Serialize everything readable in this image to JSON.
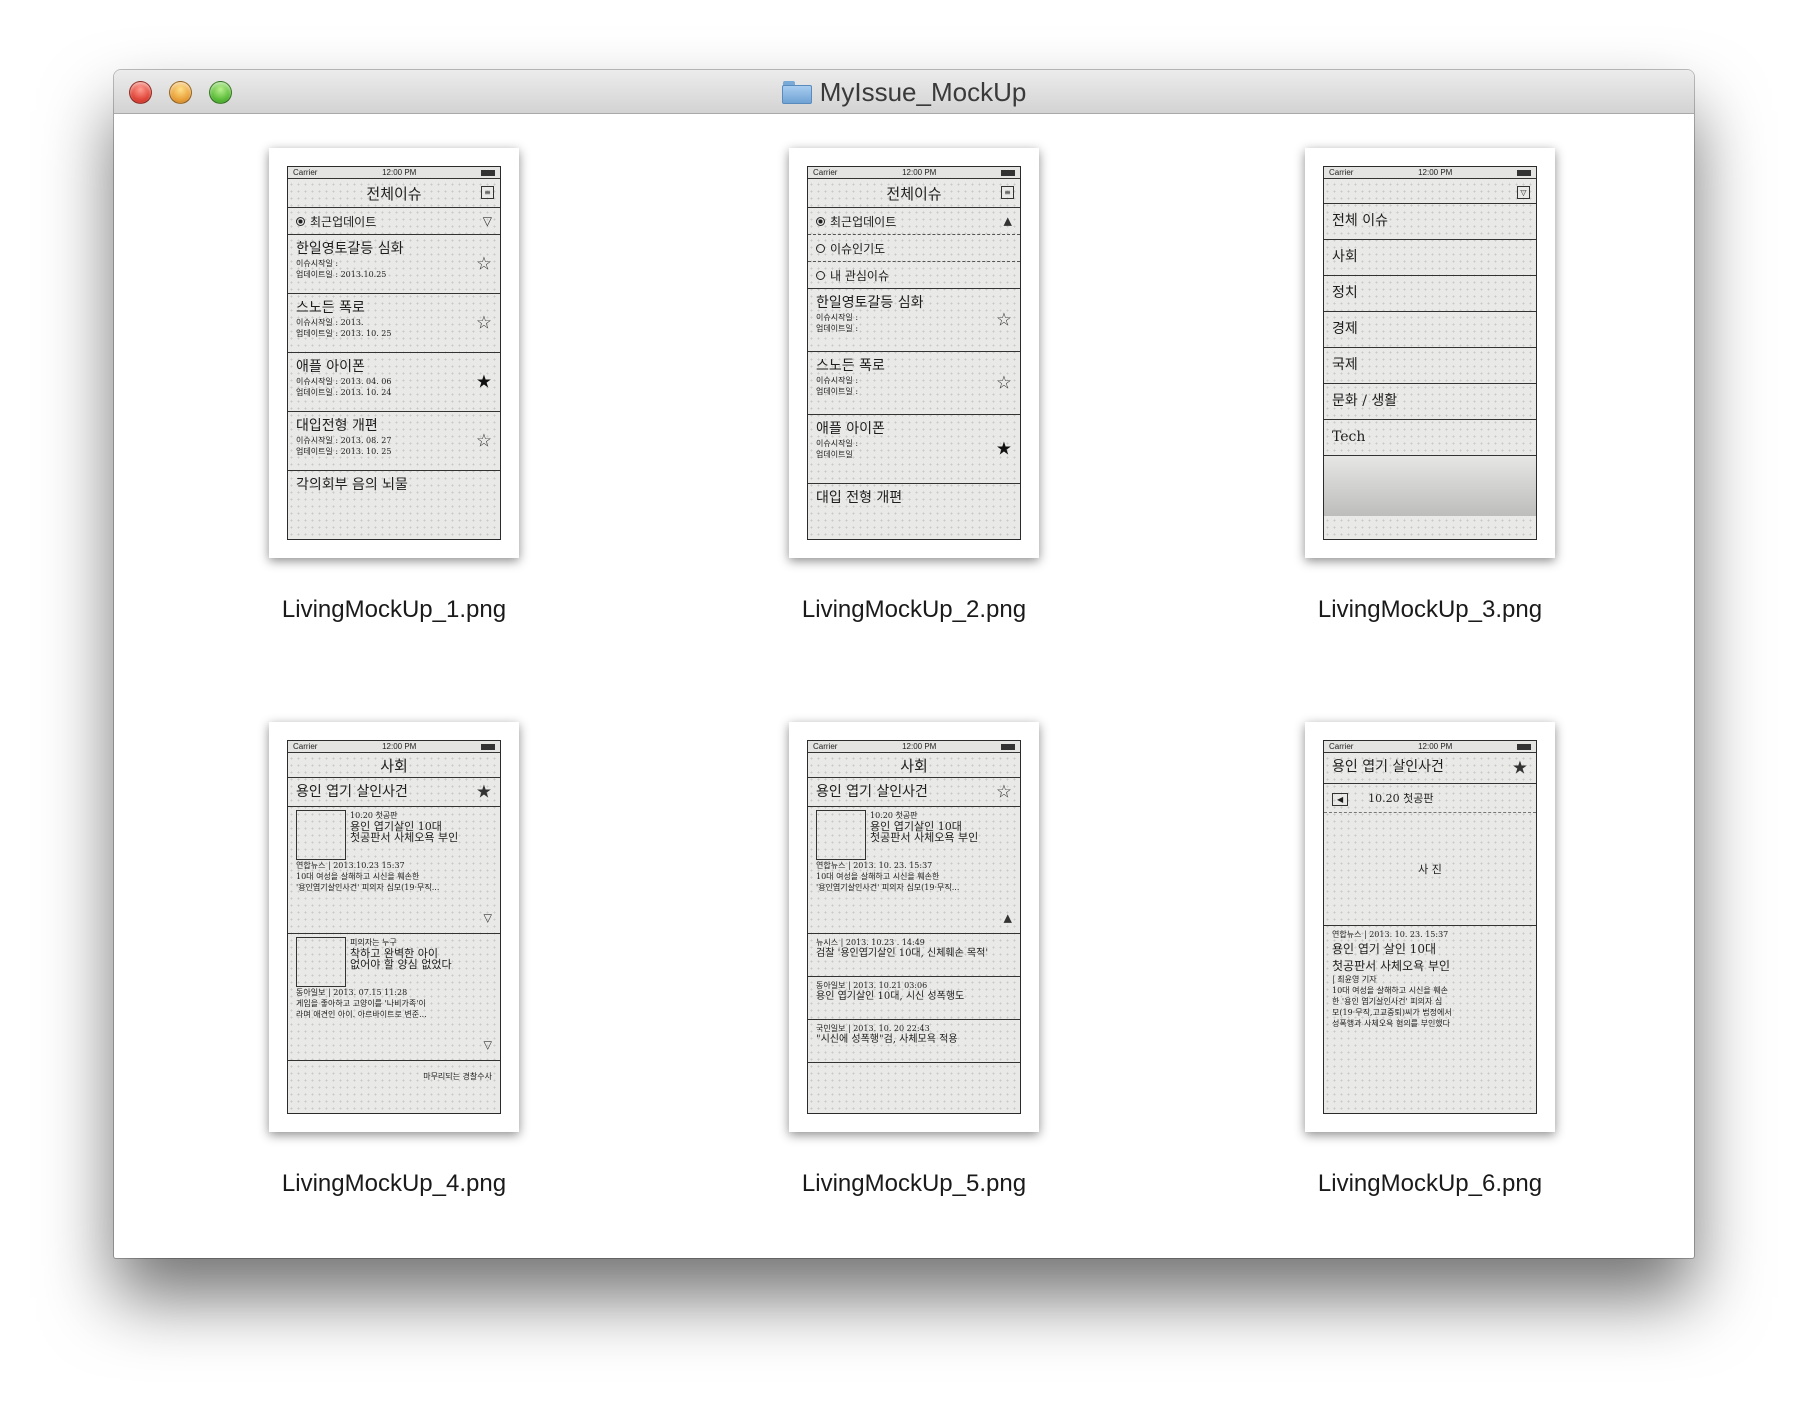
{
  "window": {
    "title": "MyIssue_MockUp"
  },
  "files": [
    {
      "name": "LivingMockUp_1.png"
    },
    {
      "name": "LivingMockUp_2.png"
    },
    {
      "name": "LivingMockUp_3.png"
    },
    {
      "name": "LivingMockUp_4.png"
    },
    {
      "name": "LivingMockUp_5.png"
    },
    {
      "name": "LivingMockUp_6.png"
    }
  ],
  "thumb": {
    "carrier": "Carrier",
    "time": "12:00 PM",
    "t1": {
      "title": "전체이슈",
      "sort": "최근업데이트",
      "rows": [
        {
          "h": "한일영토갈등 심화",
          "s1": "이슈시작일 :",
          "s2": "업데이트일 : 2013.10.25"
        },
        {
          "h": "스노든 폭로",
          "s1": "이슈시작일 : 2013.",
          "s2": "업데이트일 : 2013. 10. 25"
        },
        {
          "h": "애플 아이폰",
          "s1": "이슈시작일 : 2013. 04. 06",
          "s2": "업데이트일 : 2013. 10. 24"
        },
        {
          "h": "대입전형 개편",
          "s1": "이슈시작일 : 2013. 08. 27",
          "s2": "업데이트일 : 2013. 10. 25"
        },
        {
          "h": "각의회부 음의 뇌물"
        }
      ]
    },
    "t2": {
      "title": "전체이슈",
      "options": [
        "최근업데이트",
        "이슈인기도",
        "내 관심이슈"
      ],
      "rows": [
        {
          "h": "한일영토갈등 심화",
          "s1": "이슈시작일 :",
          "s2": "업데이트일 :"
        },
        {
          "h": "스노든 폭로",
          "s1": "이슈시작일 :",
          "s2": "업데이트일 :"
        },
        {
          "h": "애플 아이폰",
          "s1": "이슈시작일 :",
          "s2": "업데이트일"
        },
        {
          "h": "대입 전형 개편"
        }
      ]
    },
    "t3": {
      "menu": [
        "전체 이슈",
        "사회",
        "정치",
        "경제",
        "국제",
        "문화 / 생활",
        "Tech"
      ]
    },
    "t4": {
      "title": "사회",
      "issue": "용인 엽기 살인사건",
      "a1": {
        "date": "10.20 첫공판",
        "l1": "용인 엽기살인 10대",
        "l2": "첫공판서 사체오욕 부인",
        "src": "연합뉴스 | 2013.10.23 15:37",
        "b1": "10대 여성을 살해하고 시신을 훼손한",
        "b2": "'용인엽기살인사건' 피의자 심모(19·무직..."
      },
      "a2": {
        "date": "피의자는 누구",
        "l1": "착하고 완벽한 아이",
        "l2": "없어야 할 양심 없었다",
        "src": "동아일보 | 2013. 07.15 11:28",
        "b1": "게임을 좋아하고 고양이를 '나비가족'이",
        "b2": "라며 애견인 아이. 아르바이트로 변준..."
      },
      "a3": "마무리되는 경찰수사"
    },
    "t5": {
      "title": "사회",
      "issue": "용인 엽기 살인사건",
      "a1": {
        "date": "10.20 첫공판",
        "l1": "용인 엽기살인 10대",
        "l2": "첫공판서 사체오욕 부인",
        "src": "연합뉴스 | 2013. 10. 23. 15:37",
        "b1": "10대 여성을 살해하고 시신을 훼손한",
        "b2": "'용인엽기살인사건' 피의자 심모(19·무직..."
      },
      "news": [
        {
          "src": "뉴시스 | 2013. 10.23 . 14:49",
          "h": "검찰 '용인엽기살인 10대, 신체훼손 목적'"
        },
        {
          "src": "동아일보 | 2013. 10.21 03:06",
          "h": "용인 엽기살인 10대, 시신 성폭행도"
        },
        {
          "src": "국민일보 | 2013. 10. 20 22:43",
          "h": "\"시신에 성폭행\"검, 사체모욕 적용"
        }
      ]
    },
    "t6": {
      "issue": "용인 엽기 살인사건",
      "date": "10.20 첫공판",
      "photo": "사 진",
      "src": "연합뉴스 | 2013. 10. 23. 15:37",
      "h1": "용인 엽기 살인 10대",
      "h2": "첫공판서 사체오욕 부인",
      "reporter": "| 최윤영 기자",
      "b1": "10대 여성을 살해하고 시신을 훼손",
      "b2": "한 '용인 엽기살인사건' 피의자 심",
      "b3": "모(19·무직,고교중퇴)씨가 법정에서",
      "b4": "성폭행과 사체오욕 혐의를 부인했다"
    }
  }
}
